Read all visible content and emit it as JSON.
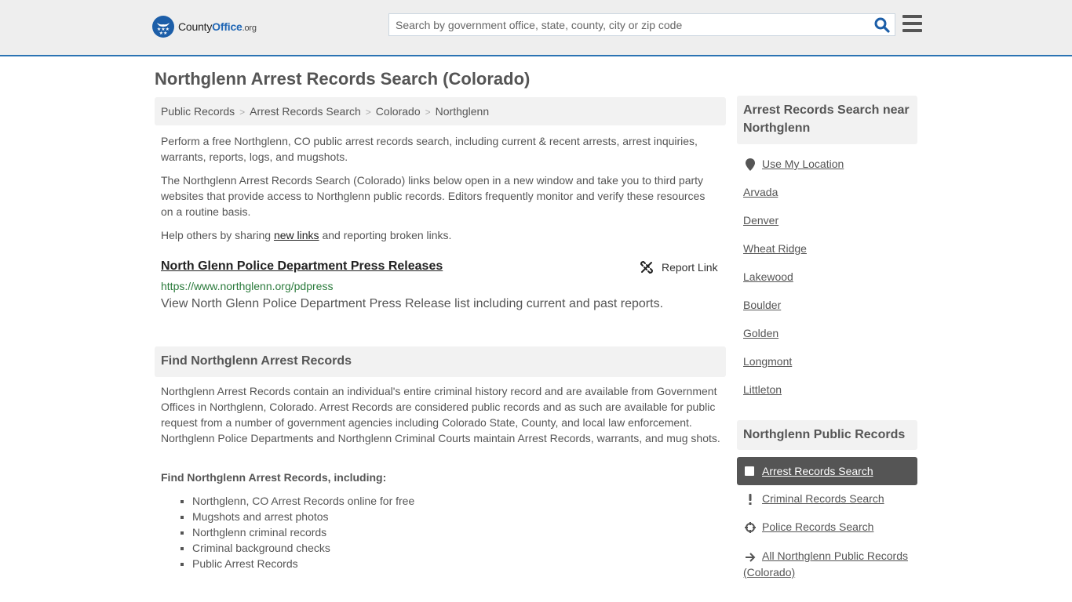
{
  "header": {
    "logo": {
      "name_part1": "County",
      "name_part2": "Office",
      "suffix": ".org"
    },
    "search": {
      "placeholder": "Search by government office, state, county, city or zip code",
      "value": ""
    },
    "colors": {
      "brand_blue": "#1f66b5",
      "header_bg": "#eeeeee",
      "accent_line": "#2b73b3"
    }
  },
  "page": {
    "title": "Northglenn Arrest Records Search (Colorado)",
    "breadcrumb": [
      "Public Records",
      "Arrest Records Search",
      "Colorado",
      "Northglenn"
    ],
    "intro": {
      "p1": "Perform a free Northglenn, CO public arrest records search, including current & recent arrests, arrest inquiries, warrants, reports, logs, and mugshots.",
      "p2": "The Northglenn Arrest Records Search (Colorado) links below open in a new window and take you to third party websites that provide access to Northglenn public records. Editors frequently monitor and verify these resources on a routine basis.",
      "p3_before": "Help others by sharing ",
      "p3_link": "new links",
      "p3_after": " and reporting broken links."
    },
    "results": [
      {
        "title": "North Glenn Police Department Press Releases",
        "url": "https://www.northglenn.org/pdpress",
        "description": "View North Glenn Police Department Press Release list including current and past reports.",
        "report_label": "Report Link"
      }
    ],
    "find_section": {
      "header": "Find Northglenn Arrest Records",
      "body": "Northglenn Arrest Records contain an individual's entire criminal history record and are available from Government Offices in Northglenn, Colorado. Arrest Records are considered public records and as such are available for public request from a number of government agencies including Colorado State, County, and local law enforcement. Northglenn Police Departments and Northglenn Criminal Courts maintain Arrest Records, warrants, and mug shots.",
      "sub_heading": "Find Northglenn Arrest Records, including:",
      "bullets": [
        "Northglenn, CO Arrest Records online for free",
        "Mugshots and arrest photos",
        "Northglenn criminal records",
        "Criminal background checks",
        "Public Arrest Records"
      ]
    }
  },
  "sidebar": {
    "nearby": {
      "header": "Arrest Records Search near Northglenn",
      "use_location": "Use My Location",
      "cities": [
        "Arvada",
        "Denver",
        "Wheat Ridge",
        "Lakewood",
        "Boulder",
        "Golden",
        "Longmont",
        "Littleton"
      ]
    },
    "public_records": {
      "header": "Northglenn Public Records",
      "items": [
        {
          "label": "Arrest Records Search",
          "icon": "square-icon",
          "active": true
        },
        {
          "label": "Criminal Records Search",
          "icon": "exclamation-icon",
          "active": false
        },
        {
          "label": "Police Records Search",
          "icon": "crosshair-icon",
          "active": false
        },
        {
          "label": "All Northglenn Public Records (Colorado)",
          "icon": "arrow-right-icon",
          "active": false
        }
      ]
    }
  }
}
